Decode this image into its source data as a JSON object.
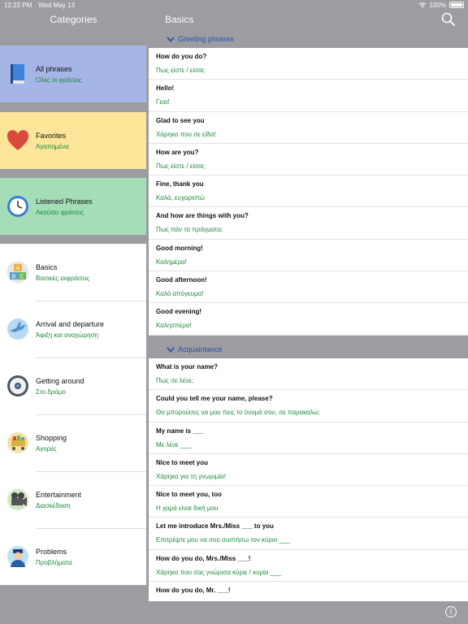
{
  "status": {
    "time": "12:22 PM",
    "date": "Wed May 13",
    "battery": "100%"
  },
  "nav": {
    "left_title": "Categories",
    "right_title": "Basics"
  },
  "categories": [
    {
      "en": "All phrases",
      "gr": "Όλες οι φράσεις",
      "icon": "book-icon"
    },
    {
      "en": "Favorites",
      "gr": "Αγαπημένα",
      "icon": "heart-icon"
    },
    {
      "en": "Listened Phrases",
      "gr": "Ακούσει φράσεις",
      "icon": "clock-icon"
    },
    {
      "en": "Basics",
      "gr": "Βασικές εκφράσεις",
      "icon": "abc-blocks-icon"
    },
    {
      "en": "Arrival and departure",
      "gr": "Άφιξη και αναχώρηση",
      "icon": "airplane-globe-icon"
    },
    {
      "en": "Getting around",
      "gr": "Στο δρόμο",
      "icon": "steering-wheel-icon"
    },
    {
      "en": "Shopping",
      "gr": "Αγορές",
      "icon": "shopping-cart-icon"
    },
    {
      "en": "Entertainment",
      "gr": "Διασκέδαση",
      "icon": "movie-camera-icon"
    },
    {
      "en": "Problems",
      "gr": "Προβλήματα",
      "icon": "police-officer-icon"
    }
  ],
  "sections": [
    {
      "title": "Greeting phrases",
      "phrases": [
        {
          "en": "How do you do?",
          "gr": "Πως είστε / είσαι;"
        },
        {
          "en": "Hello!",
          "gr": "Γεια!"
        },
        {
          "en": "Glad to see you",
          "gr": "Χάρηκα που σε είδα!"
        },
        {
          "en": "How are you?",
          "gr": "Πως είστε / είσαι;"
        },
        {
          "en": "Fine, thank you",
          "gr": "Καλά, ευχαριστώ"
        },
        {
          "en": "And how are things with you?",
          "gr": "Πως πάν τα πράγματα;"
        },
        {
          "en": "Good morning!",
          "gr": "Καλημέρα!"
        },
        {
          "en": "Good afternoon!",
          "gr": "Καλό απόγευμα!"
        },
        {
          "en": "Good evening!",
          "gr": "Καλησπέρα!"
        }
      ]
    },
    {
      "title": "Acquaintance",
      "phrases": [
        {
          "en": "What is your name?",
          "gr": "Πως σε λένε;"
        },
        {
          "en": "Could you tell me your name, please?",
          "gr": "Θα μπορούσες να μου πεις το όνομά σου, σε παρακαλώ;"
        },
        {
          "en": "My name is ___",
          "gr": "Με λένε ___"
        },
        {
          "en": "Nice to meet you",
          "gr": "Χάρηκα για τη γνωριμία!"
        },
        {
          "en": "Nice to meet you, too",
          "gr": "Η χαρά είναι δική μου"
        },
        {
          "en": "Let me introduce Mrs./Miss ___ to you",
          "gr": "Επιτρέψτε μου να σου συστήσω τον κύριο ___"
        },
        {
          "en": "How do you do, Mrs./Miss ___!",
          "gr": "Χάρηκα που σας γνώρισα κύριε / κυρία ___"
        },
        {
          "en": "How do you do, Mr. ___!",
          "gr": ""
        }
      ]
    }
  ],
  "info_label": "i"
}
